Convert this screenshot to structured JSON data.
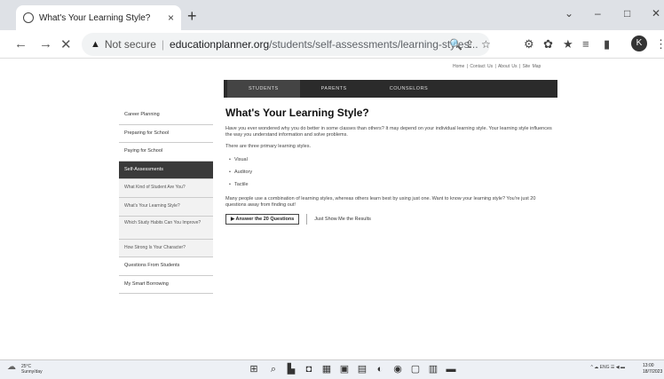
{
  "browser": {
    "tab_title": "What's Your Learning Style?",
    "tab_close": "×",
    "new_tab": "+",
    "window_controls": [
      "⌄",
      "–",
      "□",
      "✕"
    ],
    "nav": {
      "back": "←",
      "forward": "→",
      "reload": "✕"
    },
    "omnibox": {
      "security_icon": "▲",
      "security_label": "Not secure",
      "url_domain": "educationplanner.org",
      "url_path": "/students/self-assessments/learning-styles...",
      "search_icon": "🔍",
      "share_icon": "⇪",
      "star_icon": "☆"
    },
    "extension_icons": [
      "⚙",
      "✿",
      "★",
      "≡",
      "▮"
    ],
    "avatar": "K",
    "menu": "⋮"
  },
  "site": {
    "top_links": "Home | Contact Us | About Us | Site Map",
    "main_nav": [
      "STUDENTS",
      "PARENTS",
      "COUNSELORS"
    ],
    "sidebar": [
      "Career Planning",
      "Preparing for School",
      "Paying for School",
      "Self-Assessments",
      "What Kind of Student Are You?",
      "What's Your Learning Style?",
      "Which Study Habits Can You Improve?",
      "How Strong Is Your Character?",
      "Questions From Students",
      "My Smart Borrowing"
    ],
    "heading": "What's Your Learning Style?",
    "intro": "Have you ever wondered why you do better in some classes than others? It may depend on your individual learning style. Your learning style influences the way you understand information and solve problems.",
    "styles_intro": "There are three primary learning styles.",
    "styles": [
      "Visual",
      "Auditory",
      "Tactile"
    ],
    "closing": "Many people use a combination of learning styles, whereas others learn best by using just one. Want to know your learning style? You're just 20 questions away from finding out!",
    "cta_primary": "▶ Answer the 20 Questions",
    "cta_secondary": "Just Show Me the Results"
  },
  "taskbar": {
    "temp": "25°C",
    "condition": "Sunny/day",
    "tray": "^ ☁ ENG ☰ ◀ ▬",
    "time": "13:00",
    "date": "18/7/2023"
  }
}
